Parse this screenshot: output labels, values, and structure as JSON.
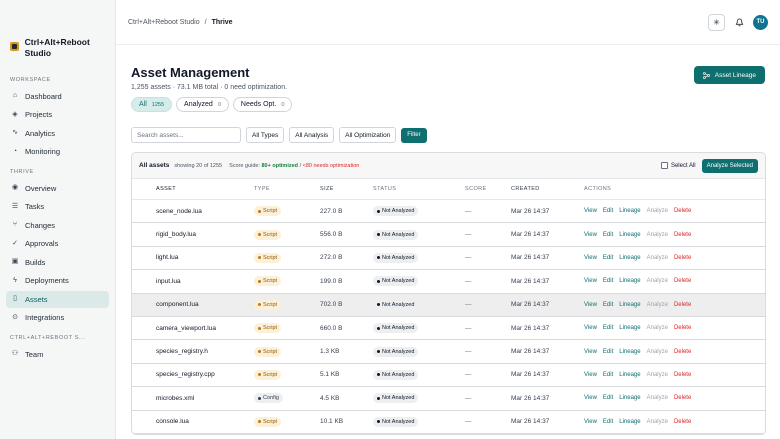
{
  "brand": {
    "name": "Ctrl+Alt+Reboot Studio"
  },
  "sidebar": {
    "sections": [
      {
        "label": "WORKSPACE",
        "items": [
          {
            "label": "Dashboard",
            "icon": "home-icon"
          },
          {
            "label": "Projects",
            "icon": "layers-icon"
          },
          {
            "label": "Analytics",
            "icon": "activity-icon"
          },
          {
            "label": "Monitoring",
            "icon": "monitor-icon"
          }
        ]
      },
      {
        "label": "THRIVE",
        "items": [
          {
            "label": "Overview",
            "icon": "eye-icon"
          },
          {
            "label": "Tasks",
            "icon": "tasks-icon"
          },
          {
            "label": "Changes",
            "icon": "branch-icon"
          },
          {
            "label": "Approvals",
            "icon": "check-icon"
          },
          {
            "label": "Builds",
            "icon": "package-icon"
          },
          {
            "label": "Deployments",
            "icon": "zap-icon"
          },
          {
            "label": "Assets",
            "icon": "file-icon",
            "active": true
          },
          {
            "label": "Integrations",
            "icon": "plug-icon"
          }
        ]
      },
      {
        "label": "CTRL+ALT+REBOOT S...",
        "items": [
          {
            "label": "Team",
            "icon": "users-icon"
          }
        ]
      }
    ]
  },
  "topbar": {
    "breadcrumb": [
      "Ctrl+Alt+Reboot Studio",
      "/",
      "Thrive"
    ],
    "avatar": "TU"
  },
  "header": {
    "title": "Asset Management",
    "subtitle": "1,255 assets · 73.1 MB total · 0 need optimization.",
    "lineage_button": "Asset Lineage"
  },
  "pills": [
    {
      "label": "All",
      "count": "1255",
      "active": true
    },
    {
      "label": "Analyzed",
      "count": "0"
    },
    {
      "label": "Needs Opt.",
      "count": "0"
    }
  ],
  "filters": {
    "search_placeholder": "Search assets...",
    "types": "All Types",
    "analysis": "All Analysis",
    "optimization": "All Optimization",
    "button": "Filter"
  },
  "table": {
    "head_label": "All assets",
    "showing": "showing 20 of 1255",
    "guide_prefix": "Score guide:",
    "guide_good": "80+ optimized",
    "guide_sep": "/",
    "guide_bad": "<80 needs optimization",
    "select_all": "Select All",
    "analyze_selected": "Analyze Selected",
    "columns": [
      "ASSET",
      "TYPE",
      "SIZE",
      "STATUS",
      "SCORE",
      "CREATED",
      "ACTIONS"
    ],
    "actions": {
      "view": "View",
      "edit": "Edit",
      "lineage": "Lineage",
      "analyze": "Analyze",
      "delete": "Delete"
    },
    "rows": [
      {
        "asset": "scene_node.lua",
        "type": "Script",
        "size": "227.0 B",
        "status": "Not Analyzed",
        "score": "—",
        "created": "Mar 26 14:37"
      },
      {
        "asset": "rigid_body.lua",
        "type": "Script",
        "size": "556.0 B",
        "status": "Not Analyzed",
        "score": "—",
        "created": "Mar 26 14:37"
      },
      {
        "asset": "light.lua",
        "type": "Script",
        "size": "272.0 B",
        "status": "Not Analyzed",
        "score": "—",
        "created": "Mar 26 14:37"
      },
      {
        "asset": "input.lua",
        "type": "Script",
        "size": "199.0 B",
        "status": "Not Analyzed",
        "score": "—",
        "created": "Mar 26 14:37"
      },
      {
        "asset": "component.lua",
        "type": "Script",
        "size": "702.0 B",
        "status": "Not Analyzed",
        "score": "—",
        "created": "Mar 26 14:37",
        "highlight": true
      },
      {
        "asset": "camera_viewport.lua",
        "type": "Script",
        "size": "660.0 B",
        "status": "Not Analyzed",
        "score": "—",
        "created": "Mar 26 14:37"
      },
      {
        "asset": "species_registry.h",
        "type": "Script",
        "size": "1.3 KB",
        "status": "Not Analyzed",
        "score": "—",
        "created": "Mar 26 14:37"
      },
      {
        "asset": "species_registry.cpp",
        "type": "Script",
        "size": "5.1 KB",
        "status": "Not Analyzed",
        "score": "—",
        "created": "Mar 26 14:37"
      },
      {
        "asset": "microbes.xml",
        "type": "Config",
        "size": "4.5 KB",
        "status": "Not Analyzed",
        "score": "—",
        "created": "Mar 26 14:37"
      },
      {
        "asset": "console.lua",
        "type": "Script",
        "size": "10.1 KB",
        "status": "Not Analyzed",
        "score": "—",
        "created": "Mar 26 14:37"
      }
    ]
  },
  "colors": {
    "accent": "#0f6e6e",
    "danger": "#dc2626",
    "success": "#15803d"
  }
}
